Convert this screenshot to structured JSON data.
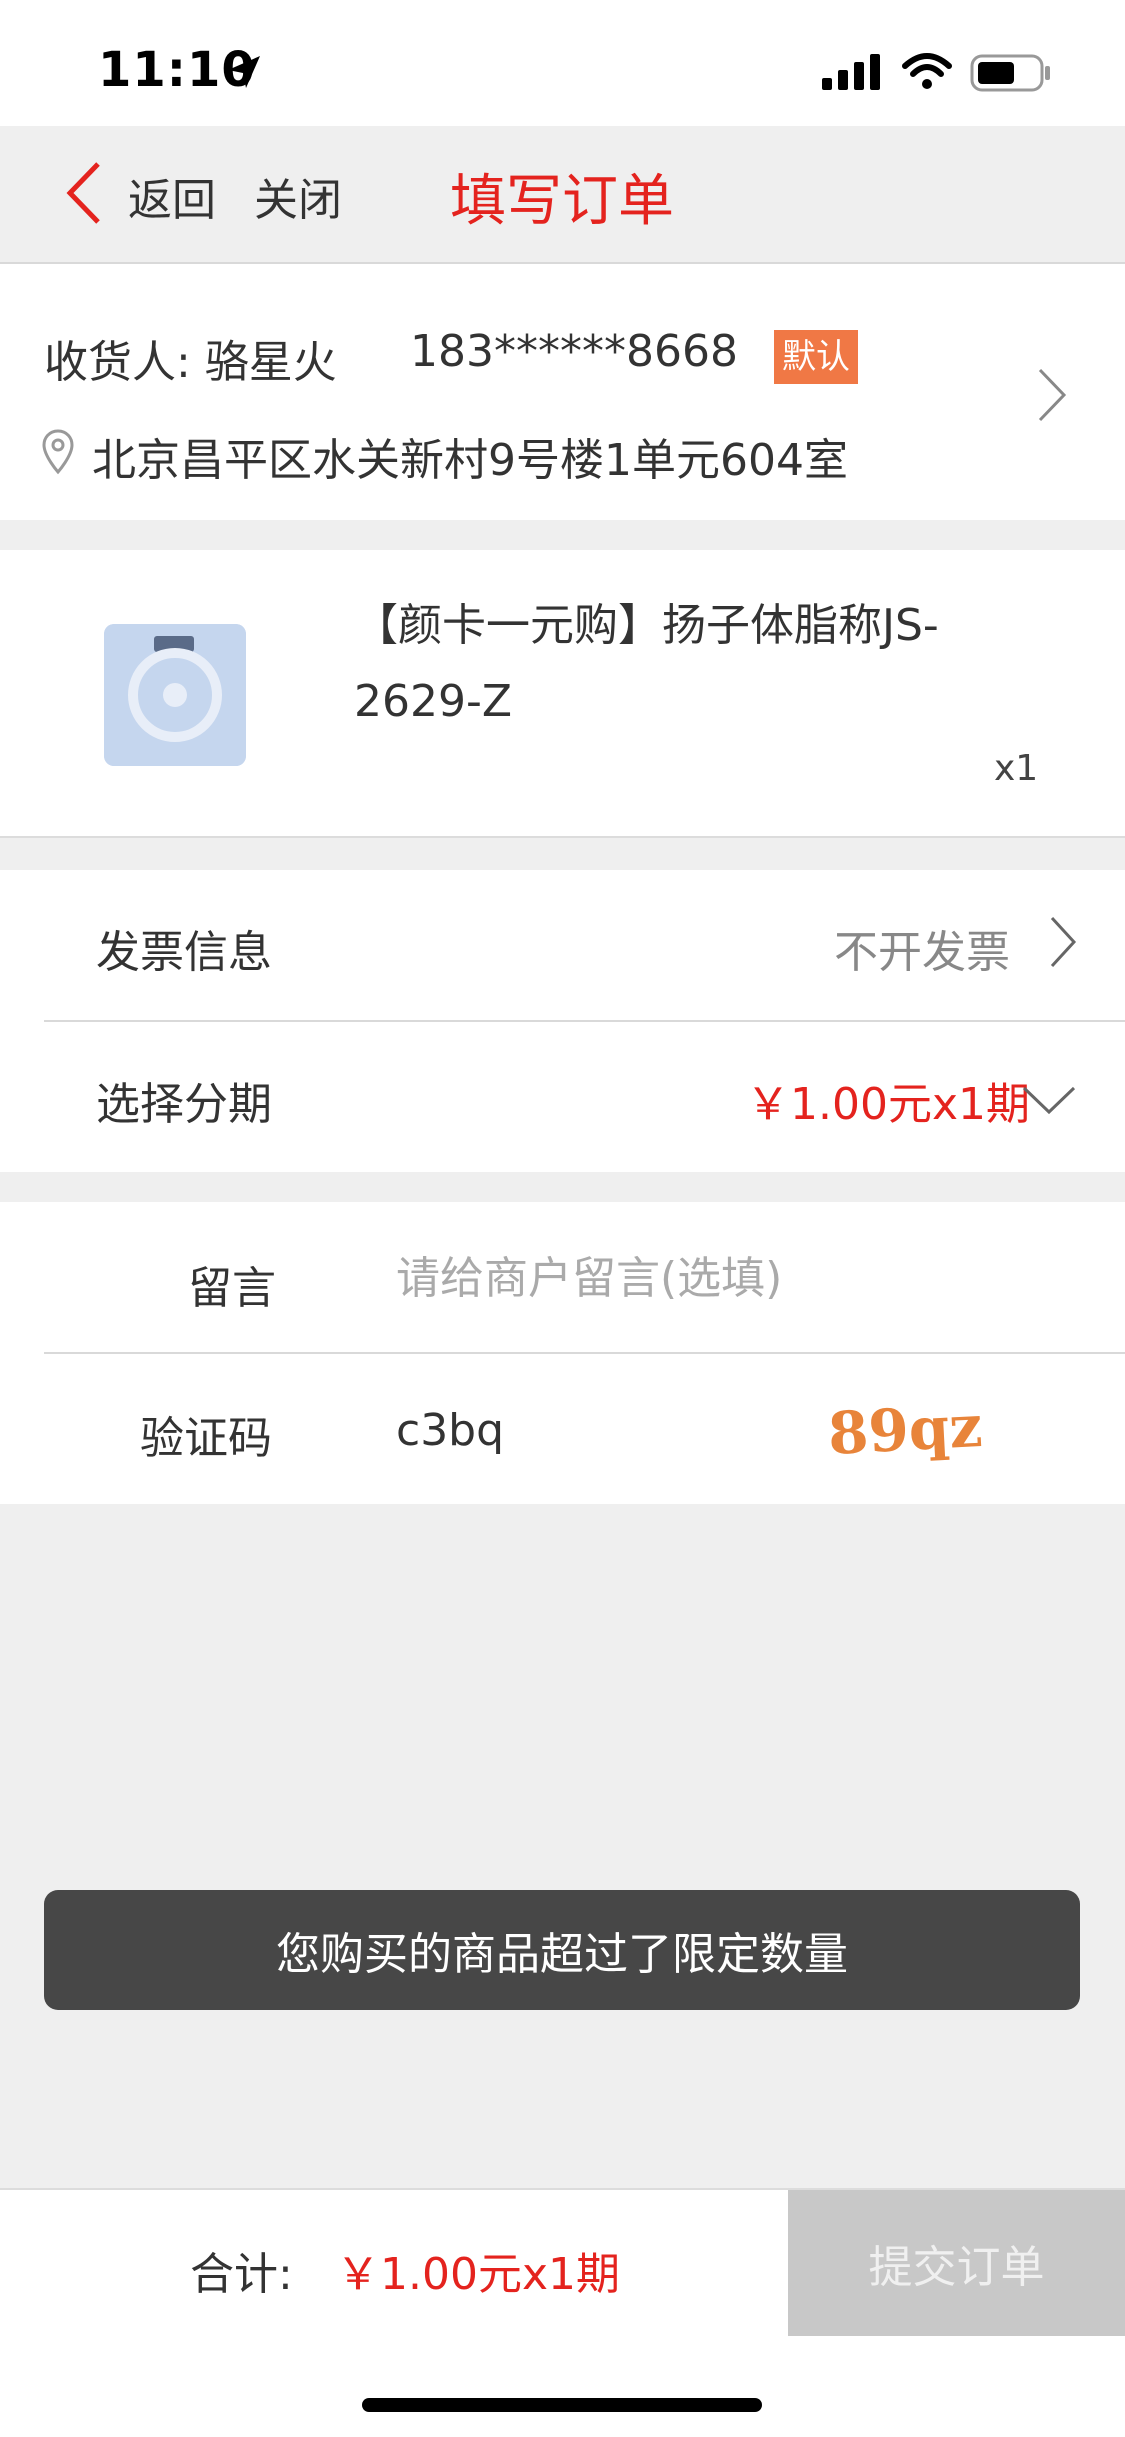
{
  "status_bar": {
    "time": "11:10"
  },
  "nav": {
    "back_label": "返回",
    "close_label": "关闭",
    "title": "填写订单"
  },
  "address": {
    "receiver": "收货人: 骆星火",
    "phone": "183******8668",
    "default_badge": "默认",
    "detail": "北京昌平区水关新村9号楼1单元604室"
  },
  "product": {
    "name": "【颜卡一元购】扬子体脂称JS-2629-Z",
    "quantity": "x1"
  },
  "invoice": {
    "label": "发票信息",
    "value": "不开发票"
  },
  "installment": {
    "label": "选择分期",
    "value": "￥1.00元x1期"
  },
  "message": {
    "label": "留言",
    "placeholder": "请给商户留言(选填)"
  },
  "captcha": {
    "label": "验证码",
    "value": "c3bq",
    "image_text": "89qz"
  },
  "toast": {
    "text": "您购买的商品超过了限定数量"
  },
  "footer": {
    "total_label": "合计:",
    "total_value": "￥1.00元x1期",
    "submit_label": "提交订单"
  },
  "colors": {
    "accent": "#e4231e",
    "badge": "#f07845",
    "submit_disabled": "#c8c8c8"
  },
  "icons": [
    "location-arrow-icon",
    "signal-icon",
    "wifi-icon",
    "battery-icon",
    "chevron-left-icon",
    "location-pin-icon",
    "chevron-right-icon",
    "chevron-down-icon"
  ]
}
